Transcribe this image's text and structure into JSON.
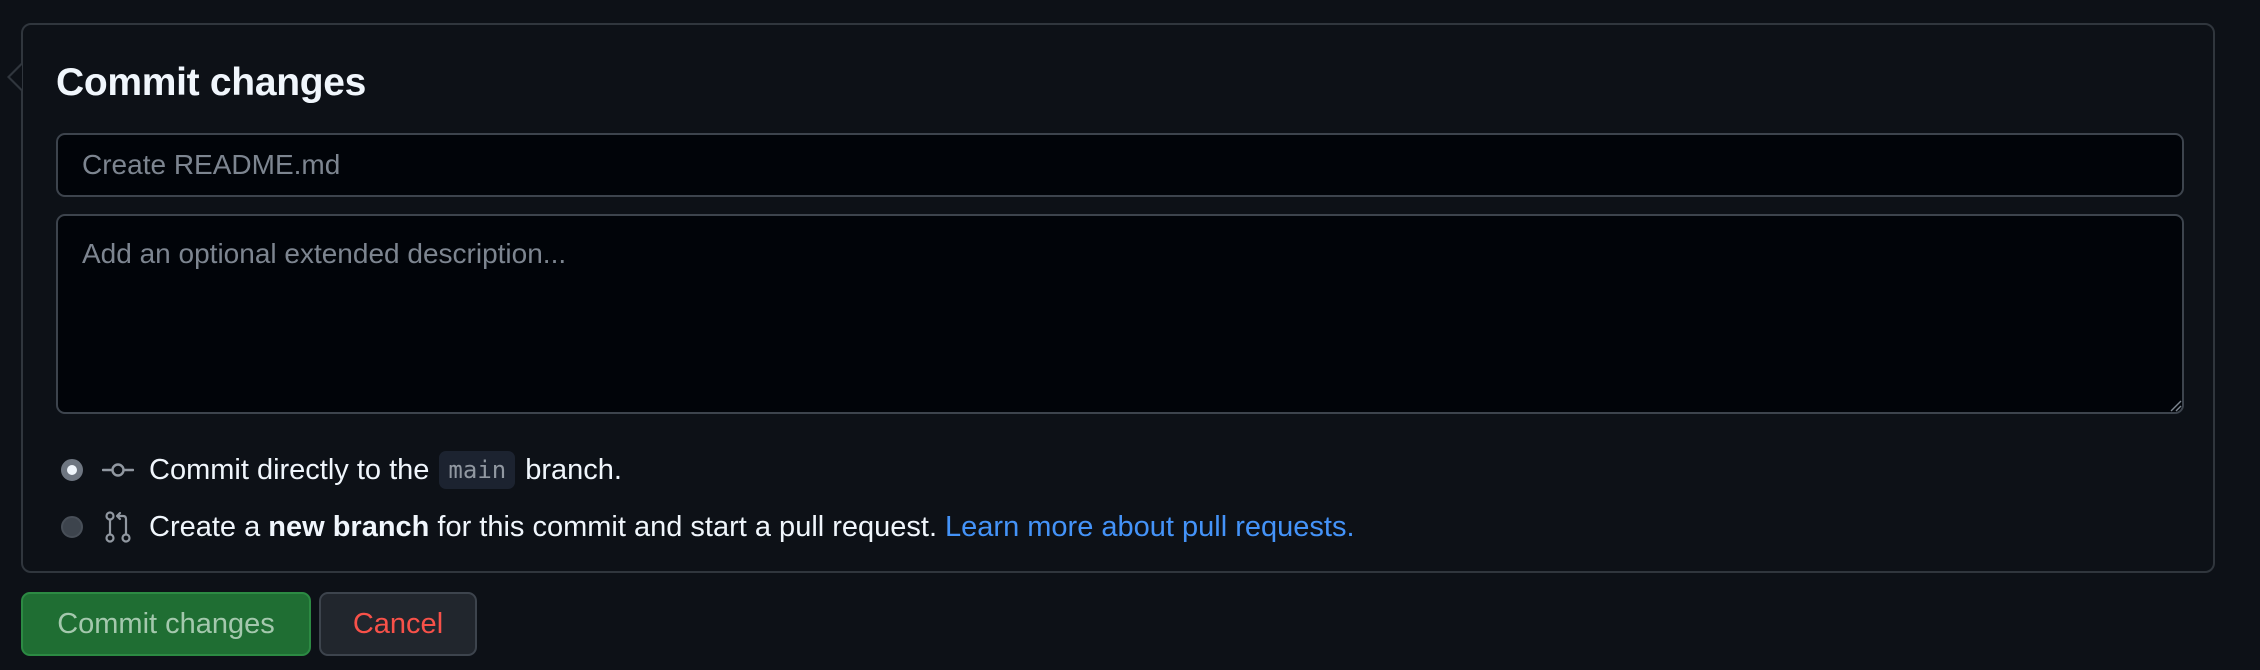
{
  "panel": {
    "title": "Commit changes"
  },
  "summary_input": {
    "value": "",
    "placeholder": "Create README.md"
  },
  "description_textarea": {
    "value": "",
    "placeholder": "Add an optional extended description..."
  },
  "options": {
    "direct": {
      "selected": true,
      "icon": "git-commit-icon",
      "text_before": "Commit directly to the",
      "branch": "main",
      "text_after": "branch."
    },
    "new_branch": {
      "selected": false,
      "icon": "git-pull-request-icon",
      "text_before": "Create a",
      "bold": "new branch",
      "text_after": "for this commit and start a pull request.",
      "link": "Learn more about pull requests."
    }
  },
  "buttons": {
    "commit_label": "Commit changes",
    "cancel_label": "Cancel"
  },
  "colors": {
    "background": "#0d1117",
    "border": "#30363d",
    "link": "#4493f8",
    "commit_button": "#1f6e33",
    "cancel_text": "#f85149"
  }
}
